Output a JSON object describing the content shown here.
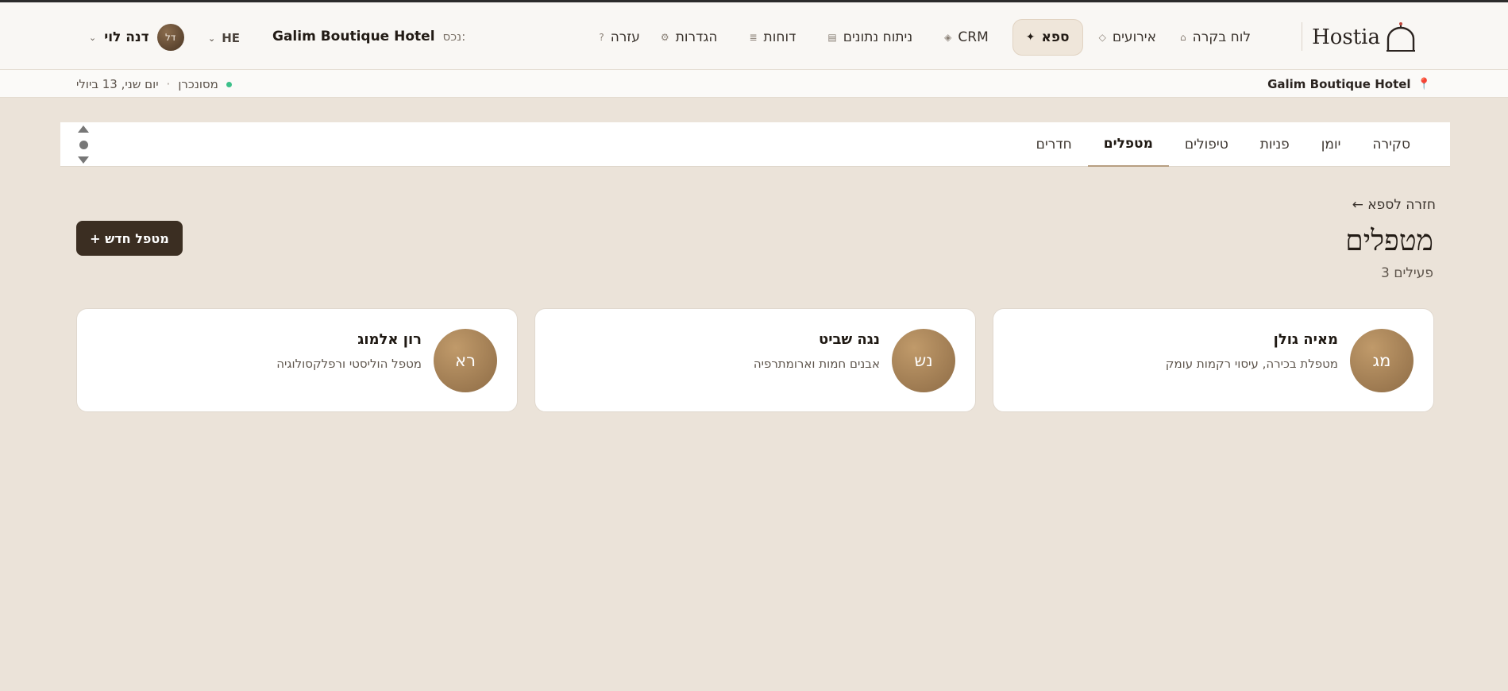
{
  "app": {
    "logo_text": "Hostia"
  },
  "nav": {
    "items": [
      {
        "label": "לוח בקרה",
        "icon": "⌂"
      },
      {
        "label": "אירועים",
        "icon": "◇"
      },
      {
        "label": "ספא",
        "icon": "✦"
      },
      {
        "label": "CRM",
        "icon": "◈"
      },
      {
        "label": "ניתוח נתונים",
        "icon": "▤"
      },
      {
        "label": "דוחות",
        "icon": "≣"
      },
      {
        "label": "הגדרות",
        "icon": "⚙"
      },
      {
        "label": "עזרה",
        "icon": "?"
      }
    ],
    "active": "ספא"
  },
  "property": {
    "label": "נכס:",
    "name": "Galim Boutique Hotel"
  },
  "lang": {
    "code": "HE",
    "chevron": "⌄"
  },
  "user": {
    "name": "דנה לוי",
    "initials": "דל",
    "chevron": "⌄"
  },
  "subbar": {
    "hotel": "Galim Boutique Hotel",
    "sync_status": "מסונכרן",
    "date": "יום שני, 13 ביולי",
    "pin_icon": "📍",
    "separator": "·"
  },
  "tabs": [
    "סקירה",
    "יומן",
    "פניות",
    "טיפולים",
    "מטפלים",
    "חדרים"
  ],
  "active_tab": "מטפלים",
  "page": {
    "back_link": "← חזרה לספא",
    "title": "מטפלים",
    "count": "3 פעילים",
    "new_button": "+ מטפל חדש"
  },
  "therapists": [
    {
      "initials": "מג",
      "name": "מאיה גולן",
      "desc": "מטפלת בכירה, עיסוי רקמות עומק"
    },
    {
      "initials": "נש",
      "name": "נגה שביט",
      "desc": "אבנים חמות וארומתרפיה"
    },
    {
      "initials": "רא",
      "name": "רון אלמוג",
      "desc": "מטפל הוליסטי ורפלקסולוגיה"
    }
  ],
  "colors": {
    "background": "#ebe3d9",
    "primary_button": "#3b2e22",
    "avatar_gold": "#a8845a",
    "sync_green": "#3cc08a",
    "pin_pink": "#e0607c"
  }
}
